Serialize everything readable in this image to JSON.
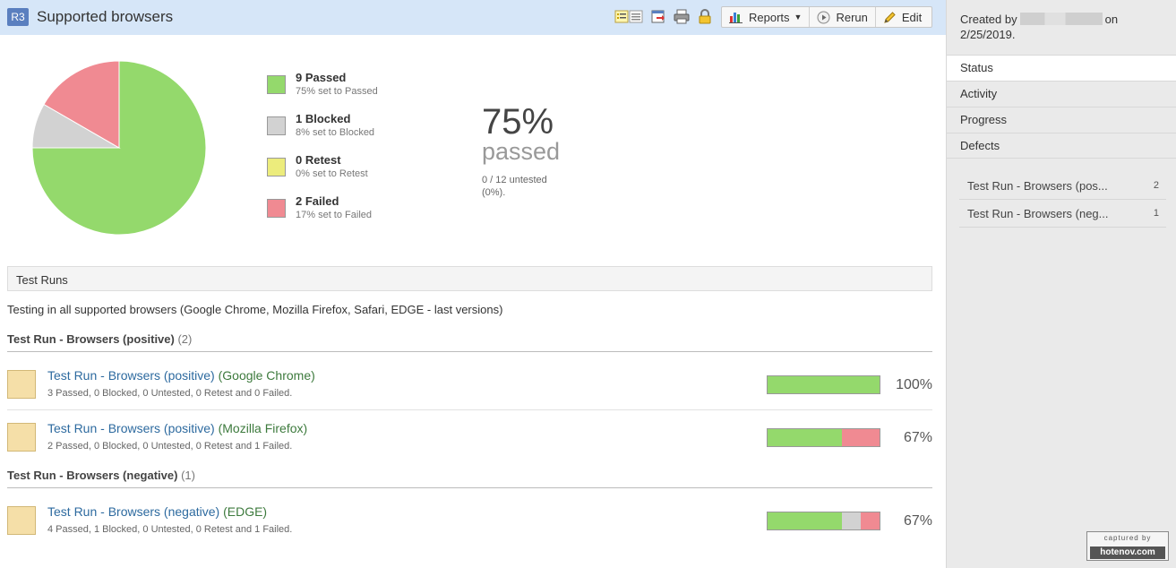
{
  "header": {
    "badge": "R3",
    "title": "Supported browsers",
    "buttons": {
      "reports": "Reports",
      "rerun": "Rerun",
      "edit": "Edit"
    }
  },
  "summary": {
    "legend": [
      {
        "title": "9 Passed",
        "sub": "75% set to Passed",
        "color": "#94d96c"
      },
      {
        "title": "1 Blocked",
        "sub": "8% set to Blocked",
        "color": "#d2d2d2"
      },
      {
        "title": "0 Retest",
        "sub": "0% set to Retest",
        "color": "#ecec7c"
      },
      {
        "title": "2 Failed",
        "sub": "17% set to Failed",
        "color": "#f08a92"
      }
    ],
    "percent": "75%",
    "percent_label": "passed",
    "untested": "0 / 12 untested (0%)."
  },
  "chart_data": {
    "type": "pie",
    "categories": [
      "Passed",
      "Blocked",
      "Retest",
      "Failed"
    ],
    "values": [
      9,
      1,
      0,
      2
    ],
    "colors": [
      "#94d96c",
      "#d2d2d2",
      "#ecec7c",
      "#f08a92"
    ]
  },
  "test_runs": {
    "section_title": "Test Runs",
    "description": "Testing in all supported browsers (Google Chrome, Mozilla Firefox, Safari, EDGE - last versions)",
    "groups": [
      {
        "title": "Test Run - Browsers (positive)",
        "count": "(2)",
        "runs": [
          {
            "name": "Test Run - Browsers (positive)",
            "config": "(Google Chrome)",
            "stats": "3 Passed, 0 Blocked, 0 Untested, 0 Retest and 0 Failed.",
            "percent": "100%",
            "passed": 3,
            "blocked": 0,
            "failed": 0
          },
          {
            "name": "Test Run - Browsers (positive)",
            "config": "(Mozilla Firefox)",
            "stats": "2 Passed, 0 Blocked, 0 Untested, 0 Retest and 1 Failed.",
            "percent": "67%",
            "passed": 2,
            "blocked": 0,
            "failed": 1
          }
        ]
      },
      {
        "title": "Test Run - Browsers (negative)",
        "count": "(1)",
        "runs": [
          {
            "name": "Test Run - Browsers (negative)",
            "config": "(EDGE)",
            "stats": "4 Passed, 1 Blocked, 0 Untested, 0 Retest and 1 Failed.",
            "percent": "67%",
            "passed": 4,
            "blocked": 1,
            "failed": 1
          }
        ]
      }
    ]
  },
  "sidebar": {
    "created_prefix": "Created by",
    "created_suffix": "on",
    "created_date": "2/25/2019.",
    "tabs": [
      "Status",
      "Activity",
      "Progress",
      "Defects"
    ],
    "defects": [
      {
        "label": "Test Run - Browsers (pos...",
        "count": "2"
      },
      {
        "label": "Test Run - Browsers (neg...",
        "count": "1"
      }
    ]
  },
  "watermark": {
    "top": "captured by",
    "bottom": "hotenov.com"
  }
}
